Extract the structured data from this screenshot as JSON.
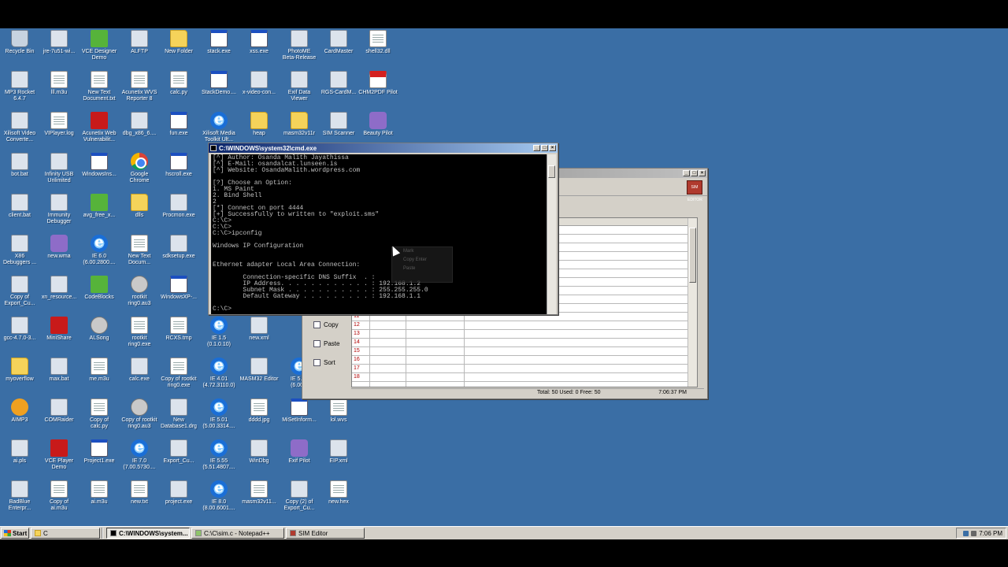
{
  "desktop": {
    "background_color": "#3a6ea5",
    "icons": [
      {
        "label": "Recycle Bin",
        "kind": "bin"
      },
      {
        "label": "jre-7u51-wi...",
        "kind": "exe"
      },
      {
        "label": "VCE Designer\nDemo",
        "kind": "green"
      },
      {
        "label": "ALFTP",
        "kind": "exe"
      },
      {
        "label": "New Folder",
        "kind": "folder"
      },
      {
        "label": "stack.exe",
        "kind": "win"
      },
      {
        "label": "xss.exe",
        "kind": "win"
      },
      {
        "label": "PhotoME\nBeta-Release",
        "kind": "exe"
      },
      {
        "label": "CardMaster",
        "kind": "exe"
      },
      {
        "label": "shell32.dll",
        "kind": "file"
      },
      {
        "label": "MP3 Rocket\n6.4.7",
        "kind": "exe"
      },
      {
        "label": "lll.m3u",
        "kind": "file"
      },
      {
        "label": "New Text\nDocument.txt",
        "kind": "file"
      },
      {
        "label": "Acunetix WVS\nReporter 8",
        "kind": "file"
      },
      {
        "label": "calc.py",
        "kind": "file"
      },
      {
        "label": "StackDemo....",
        "kind": "win"
      },
      {
        "label": "x-video-con...",
        "kind": "exe"
      },
      {
        "label": "Exif Data\nViewer",
        "kind": "exe"
      },
      {
        "label": "RGS-CardM...",
        "kind": "exe"
      },
      {
        "label": "CHM2PDF Pilot",
        "kind": "pdf"
      },
      {
        "label": "Xilisoft Video\nConverte...",
        "kind": "exe"
      },
      {
        "label": "VIPlayer.log",
        "kind": "file"
      },
      {
        "label": "Acunetix Web\nVulnerabilit...",
        "kind": "red"
      },
      {
        "label": "dbg_x86_6....",
        "kind": "exe"
      },
      {
        "label": "fun.exe",
        "kind": "win"
      },
      {
        "label": "Xilisoft Media\nToolkit Ult...",
        "kind": "ie"
      },
      {
        "label": "heap",
        "kind": "folder"
      },
      {
        "label": "masm32v11r",
        "kind": "folder"
      },
      {
        "label": "SIM Scanner",
        "kind": "exe"
      },
      {
        "label": "Beauty Pilot",
        "kind": "purple"
      },
      {
        "label": "bot.bat",
        "kind": "exe"
      },
      {
        "label": "Infinity USB\nUnlimited",
        "kind": "exe"
      },
      {
        "label": "WindowsIns...",
        "kind": "win"
      },
      {
        "label": "Google\nChrome",
        "kind": "chrome"
      },
      {
        "label": "hscroll.exe",
        "kind": "win"
      },
      {
        "label": "client.bat",
        "kind": "exe"
      },
      {
        "label": "Immunity\nDebugger",
        "kind": "exe"
      },
      {
        "label": "avg_free_x...",
        "kind": "green"
      },
      {
        "label": "dlls",
        "kind": "folder"
      },
      {
        "label": "Procmon.exe",
        "kind": "exe"
      },
      {
        "label": "X86\nDebuggers ...",
        "kind": "exe"
      },
      {
        "label": "new.wma",
        "kind": "purple"
      },
      {
        "label": "IE 6.0\n(6.00.2800....",
        "kind": "ie"
      },
      {
        "label": "New Text\nDocum...",
        "kind": "file"
      },
      {
        "label": "sdksetup.exe",
        "kind": "exe"
      },
      {
        "label": "Copy of\nExport_Cu...",
        "kind": "exe"
      },
      {
        "label": "xn_resource...",
        "kind": "exe"
      },
      {
        "label": "CodeBlocks",
        "kind": "green"
      },
      {
        "label": "rootkit\nring0.au3",
        "kind": "gray"
      },
      {
        "label": "WindowsXP-...",
        "kind": "win"
      },
      {
        "label": "gcc-4.7.0-3...",
        "kind": "exe"
      },
      {
        "label": "MiniShare",
        "kind": "red"
      },
      {
        "label": "ALSong",
        "kind": "gray"
      },
      {
        "label": "rootkit\nring0.exe",
        "kind": "file"
      },
      {
        "label": "RCXS.tmp",
        "kind": "file"
      },
      {
        "label": "IE 1.5\n(0.1.0.10)",
        "kind": "ie"
      },
      {
        "label": "new.xml",
        "kind": "exe"
      },
      {
        "label": "myoverflow",
        "kind": "folder"
      },
      {
        "label": "max.bat",
        "kind": "exe"
      },
      {
        "label": "me.m3u",
        "kind": "file"
      },
      {
        "label": "calc.exe",
        "kind": "exe"
      },
      {
        "label": "Copy of rootkit\nring0.exe",
        "kind": "file"
      },
      {
        "label": "IE 4.01\n(4.72.3110.0)",
        "kind": "ie"
      },
      {
        "label": "MASM32 Editor",
        "kind": "exe"
      },
      {
        "label": "IE 5.01\n(6.00...",
        "kind": "ie"
      },
      {
        "label": "AIMP3",
        "kind": "aimp"
      },
      {
        "label": "COMRaider",
        "kind": "exe"
      },
      {
        "label": "Copy of\ncalc.py",
        "kind": "file"
      },
      {
        "label": "Copy of rootkit\nring0.au3",
        "kind": "gray"
      },
      {
        "label": "New\nDatabase1.drg",
        "kind": "exe"
      },
      {
        "label": "IE 5.01\n(5.00.3314....",
        "kind": "ie"
      },
      {
        "label": "dddd.jpg",
        "kind": "file"
      },
      {
        "label": "MiSetInform...",
        "kind": "win"
      },
      {
        "label": "lol.wvs",
        "kind": "file"
      },
      {
        "label": "ai.pls",
        "kind": "exe"
      },
      {
        "label": "VCE Player\nDemo",
        "kind": "red"
      },
      {
        "label": "Project1.exe",
        "kind": "win"
      },
      {
        "label": "IE 7.0\n(7.00.5730....",
        "kind": "ie"
      },
      {
        "label": "Export_Cu...",
        "kind": "exe"
      },
      {
        "label": "IE 5.55\n(5.51.4807....",
        "kind": "ie"
      },
      {
        "label": "WinDbg",
        "kind": "exe"
      },
      {
        "label": "Exif Pilot",
        "kind": "purple"
      },
      {
        "label": "EIP.xml",
        "kind": "exe"
      },
      {
        "label": "BadBlue\nEnterpr...",
        "kind": "exe"
      },
      {
        "label": "Copy of\nai.m3u",
        "kind": "file"
      },
      {
        "label": "ai.m3u",
        "kind": "file"
      },
      {
        "label": "new.txt",
        "kind": "file"
      },
      {
        "label": "project.exe",
        "kind": "exe"
      },
      {
        "label": "IE 8.0\n(8.00.6001....",
        "kind": "ie"
      },
      {
        "label": "masm32v11...",
        "kind": "file"
      },
      {
        "label": "Copy (2) of\nExport_Cu...",
        "kind": "exe"
      },
      {
        "label": "new.hex",
        "kind": "file"
      }
    ]
  },
  "cmd_window": {
    "title": "C:\\WINDOWS\\system32\\cmd.exe",
    "lines": [
      "[^] Author: Osanda Malith Jayathissa",
      "[^] E-Mail: osandalcat.lunseen.is",
      "[^] Website: OsandaMalith.wordpress.com",
      "",
      "[?] Choose an Option:",
      "1. MS Paint",
      "2. Bind Shell",
      "2",
      "[*] Connect on port 4444",
      "[+] Successfully to written to \"exploit.sms\"",
      "C:\\C>",
      "C:\\C>",
      "C:\\C>ipconfig",
      "",
      "Windows IP Configuration",
      "",
      "",
      "Ethernet adapter Local Area Connection:",
      "",
      "        Connection-specific DNS Suffix  . :",
      "        IP Address. . . . . . . . . . . . : 192.168.1.2",
      "        Subnet Mask . . . . . . . . . . . : 255.255.255.0",
      "        Default Gateway . . . . . . . . . : 192.168.1.1",
      "",
      "C:\\C>"
    ],
    "context_menu": [
      "Mark",
      "Copy  Enter",
      "Paste"
    ]
  },
  "sim_window": {
    "logo_text": "SIM EDITOR",
    "side_buttons": [
      "Copy",
      "Paste",
      "Sort"
    ],
    "row_numbers": [
      "11",
      "12",
      "13",
      "14",
      "15",
      "16",
      "17",
      "18"
    ],
    "status_total": "Total: 50  Used: 0  Free: 50",
    "status_time": "7:06:37 PM"
  },
  "taskbar": {
    "start_label": "Start",
    "quick_label": "C",
    "buttons": [
      {
        "label": "C:\\WINDOWS\\system...",
        "pressed": true
      },
      {
        "label": "C:\\C\\sim.c - Notepad++",
        "pressed": false
      },
      {
        "label": "SIM Editor",
        "pressed": false
      }
    ],
    "clock": "7:06 PM"
  }
}
